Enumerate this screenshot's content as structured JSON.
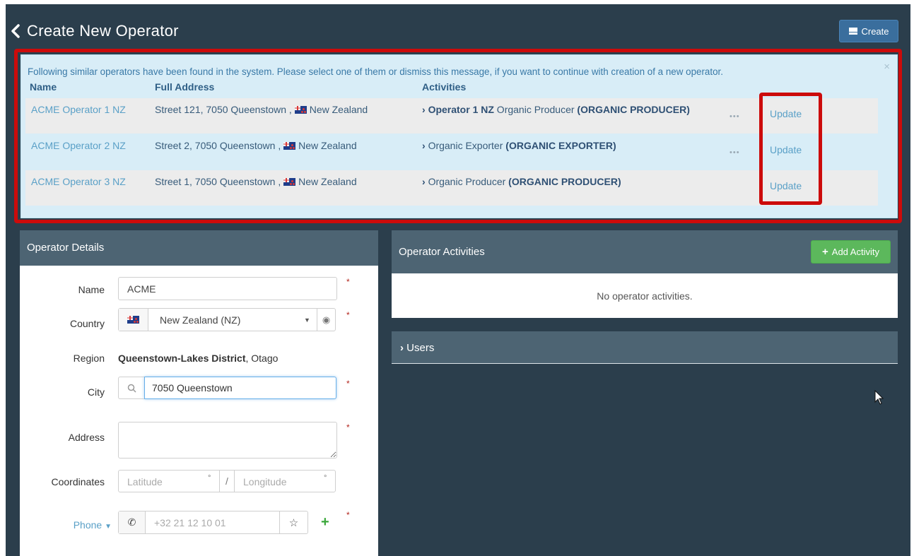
{
  "header": {
    "title": "Create New Operator",
    "create_label": "Create"
  },
  "alert": {
    "message": "Following similar operators have been found in the system. Please select one of them or dismiss this message, if you want to continue with creation of a new operator.",
    "close": "×",
    "columns": {
      "name": "Name",
      "address": "Full Address",
      "activities": "Activities"
    },
    "rows": [
      {
        "name": "ACME Operator 1 NZ",
        "address": "Street 121, 7050 Queenstown ,",
        "country": "New Zealand",
        "activity_bold_prefix": "Operator 1 NZ",
        "activity_text": " Organic Producer ",
        "activity_bold_suffix": "(ORGANIC PRODUCER)",
        "ellipsis": "•••",
        "update": "Update"
      },
      {
        "name": "ACME Operator 2 NZ",
        "address": "Street 2, 7050 Queenstown ,",
        "country": "New Zealand",
        "activity_bold_prefix": "",
        "activity_text": "Organic Exporter ",
        "activity_bold_suffix": "(ORGANIC EXPORTER)",
        "ellipsis": "•••",
        "update": "Update"
      },
      {
        "name": "ACME Operator 3 NZ",
        "address": "Street 1, 7050 Queenstown ,",
        "country": "New Zealand",
        "activity_bold_prefix": "",
        "activity_text": "Organic Producer ",
        "activity_bold_suffix": "(ORGANIC PRODUCER)",
        "ellipsis": "",
        "update": "Update"
      }
    ]
  },
  "details": {
    "title": "Operator Details",
    "name_label": "Name",
    "name_value": "ACME",
    "country_label": "Country",
    "country_value": "New Zealand (NZ)",
    "region_label": "Region",
    "region_bold": "Queenstown-Lakes District",
    "region_rest": ", Otago",
    "city_label": "City",
    "city_value": "7050 Queenstown",
    "address_label": "Address",
    "address_value": "",
    "coordinates_label": "Coordinates",
    "latitude_placeholder": "Latitude",
    "longitude_placeholder": "Longitude",
    "degree": "°",
    "separator": "/",
    "phone_label": "Phone",
    "phone_placeholder": "+32 21 12 10 01",
    "required_mark": "*"
  },
  "activities": {
    "title": "Operator Activities",
    "add_label": "Add Activity",
    "empty_text": "No operator activities."
  },
  "users": {
    "title": "Users"
  },
  "colors": {
    "background": "#2b3e4c",
    "panel_header": "#4d6473",
    "alert_bg": "#d8edf7",
    "highlight": "#cc0b0b",
    "link": "#5aa0c7",
    "success": "#5cb85c",
    "primary": "#3a6e9d"
  }
}
